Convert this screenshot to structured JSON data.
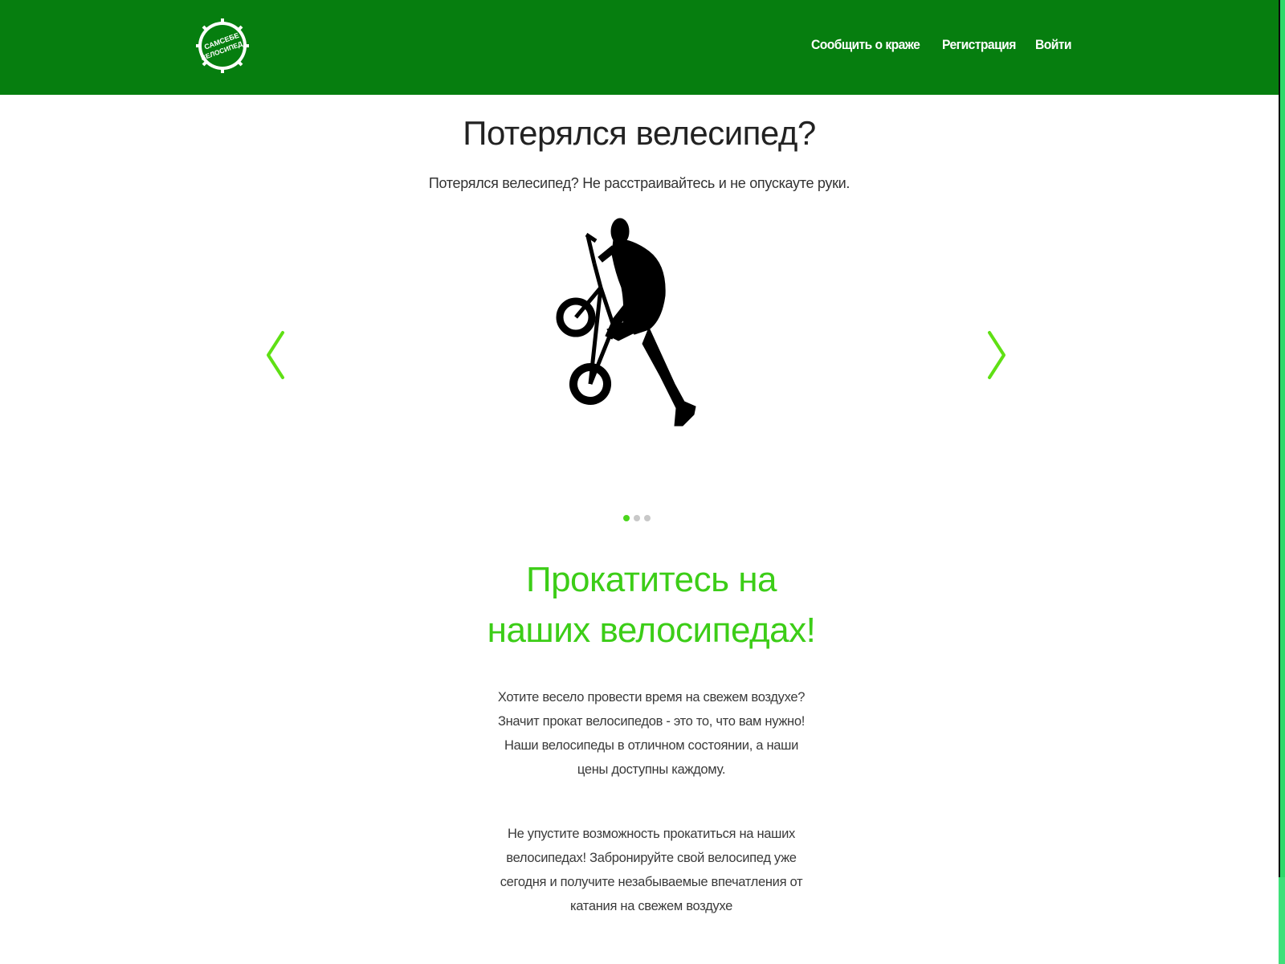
{
  "header": {
    "logo_text_top": "САМСЕБЕ",
    "logo_text_bottom": "ВЕЛОСИПЕД",
    "nav": [
      {
        "label": "Сообщить о краже"
      },
      {
        "label": "Регистрация"
      },
      {
        "label": "Войти"
      }
    ]
  },
  "hero": {
    "title": "Потерялся велесипед?",
    "subtitle": "Потерялся велесипед? Не расстраивайтесь и не опускауте руки.",
    "image_icon": "bmx-rider-silhouette-icon",
    "carousel": {
      "slide_count": 3,
      "active_slide": 1
    }
  },
  "promo": {
    "title_line1": "Прокатитесь на",
    "title_line2": "наших велосипедах!",
    "paragraph1": "Хотите весело провести время на свежем воздухе? Значит прокат велосипедов - это то, что вам нужно! Наши велосипеды в отличном состоянии, а наши цены доступны каждому.",
    "paragraph2": "Не упустите возможность прокатиться на наших велосипедах! Забронируйте свой велосипед уже сегодня и получите незабываемые впечатления от катания на свежем воздухе"
  },
  "colors": {
    "header_bg": "#067e0f",
    "accent_green": "#3ccd17",
    "arrow_green": "#5fe014",
    "dot_active": "#4bd61d",
    "dot_inactive": "#c8c8c8"
  }
}
